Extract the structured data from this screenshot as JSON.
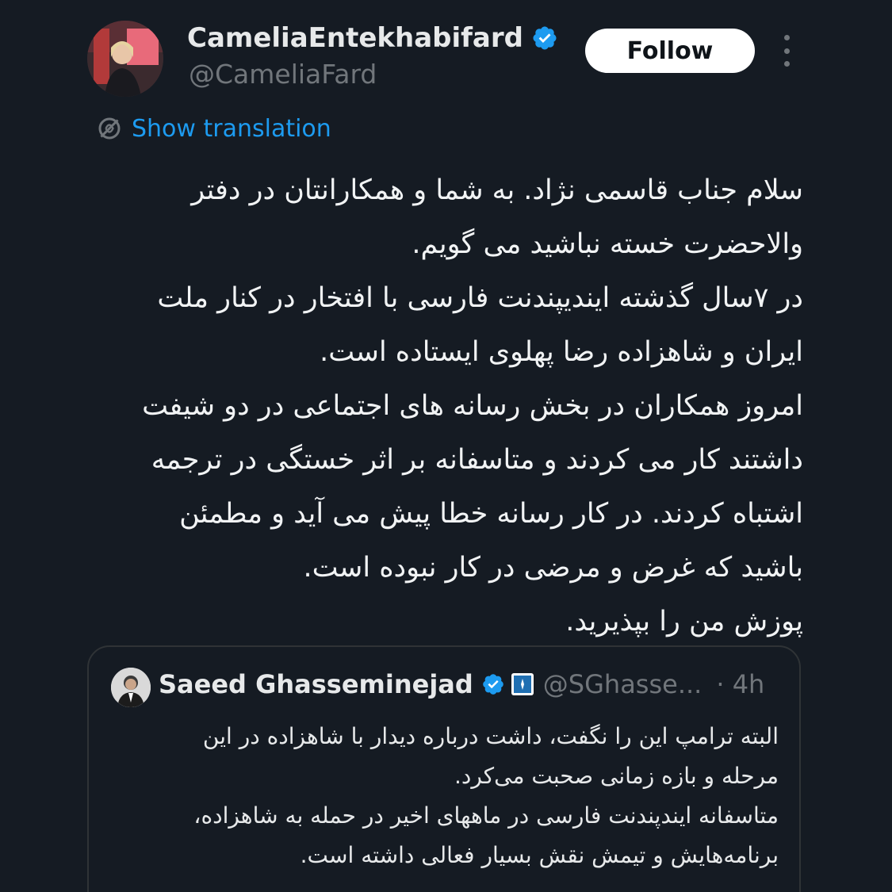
{
  "author": {
    "display_name": "CameliaEntekhabifard",
    "handle": "@CameliaFard",
    "avatar_icon": "profile-photo",
    "verified_color": "#1d9bf0"
  },
  "header": {
    "follow_label": "Follow",
    "more_icon": "more-vertical-icon"
  },
  "translation": {
    "label": "Show translation",
    "icon": "translate-icon",
    "color": "#1d9bf0"
  },
  "tweet": {
    "lines": [
      "سلام جناب قاسمی نژاد. به شما و همکارانتان در دفتر",
      "والاحضرت خسته نباشید می گویم.",
      "در ۷سال گذشته ایندیپندنت فارسی با افتخار در کنار ملت",
      "ایران و شاهزاده رضا پهلوی ایستاده است.",
      "امروز همکاران در بخش رسانه های اجتماعی در دو شیفت",
      "داشتند کار می کردند و متاسفانه بر اثر خستگی در ترجمه",
      "اشتباه کردند. در کار رسانه خطا پیش می آید و مطمئن",
      "باشید که غرض و مرضی در کار نبوده است.",
      "پوزش من را بپذیرید."
    ]
  },
  "quote": {
    "display_name": "Saeed Ghasseminejad",
    "handle": "@SGhasse...",
    "time": "· 4h",
    "lines": [
      "البته ترامپ این را نگفت، داشت درباره دیدار با شاهزاده در این",
      "مرحله و بازه زمانی صحبت می‌کرد.",
      "متاسفانه ایندپندنت فارسی در ماههای اخیر در حمله به شاهزاده،",
      "برنامه‌هایش و تیمش نقش بسیار فعالی داشته است."
    ]
  },
  "colors": {
    "background": "#151b23",
    "text": "#e7e9ea",
    "secondary_text": "#71767b",
    "accent": "#1d9bf0",
    "border": "#2f3336"
  }
}
